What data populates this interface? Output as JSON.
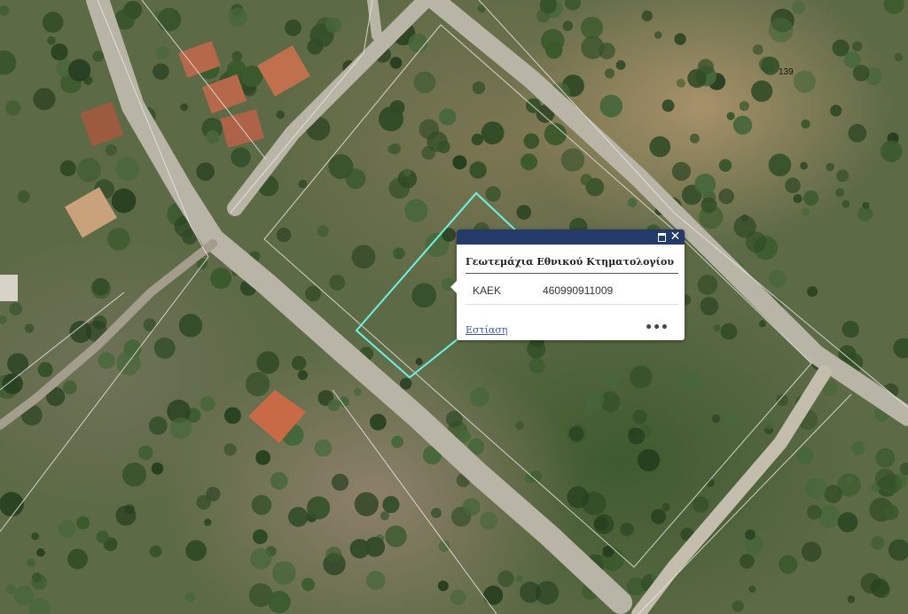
{
  "map": {
    "parcel_number_label": "139",
    "highlight_color": "#6ff2e6",
    "parcel_line_color": "#e6e6e6",
    "road_color": "#b9b5a6"
  },
  "popup": {
    "header_color": "#243a69",
    "title": "Γεωτεμάχια Εθνικού Κτηματολογίου",
    "attribute_name": "ΚΑΕΚ",
    "attribute_value": "460990911009",
    "zoom_link": "Εστίαση",
    "maximize_icon": "maximize-icon",
    "close_icon": "close-icon",
    "close_glyph": "✕",
    "more_icon": "more-icon",
    "more_glyph": "•••"
  }
}
